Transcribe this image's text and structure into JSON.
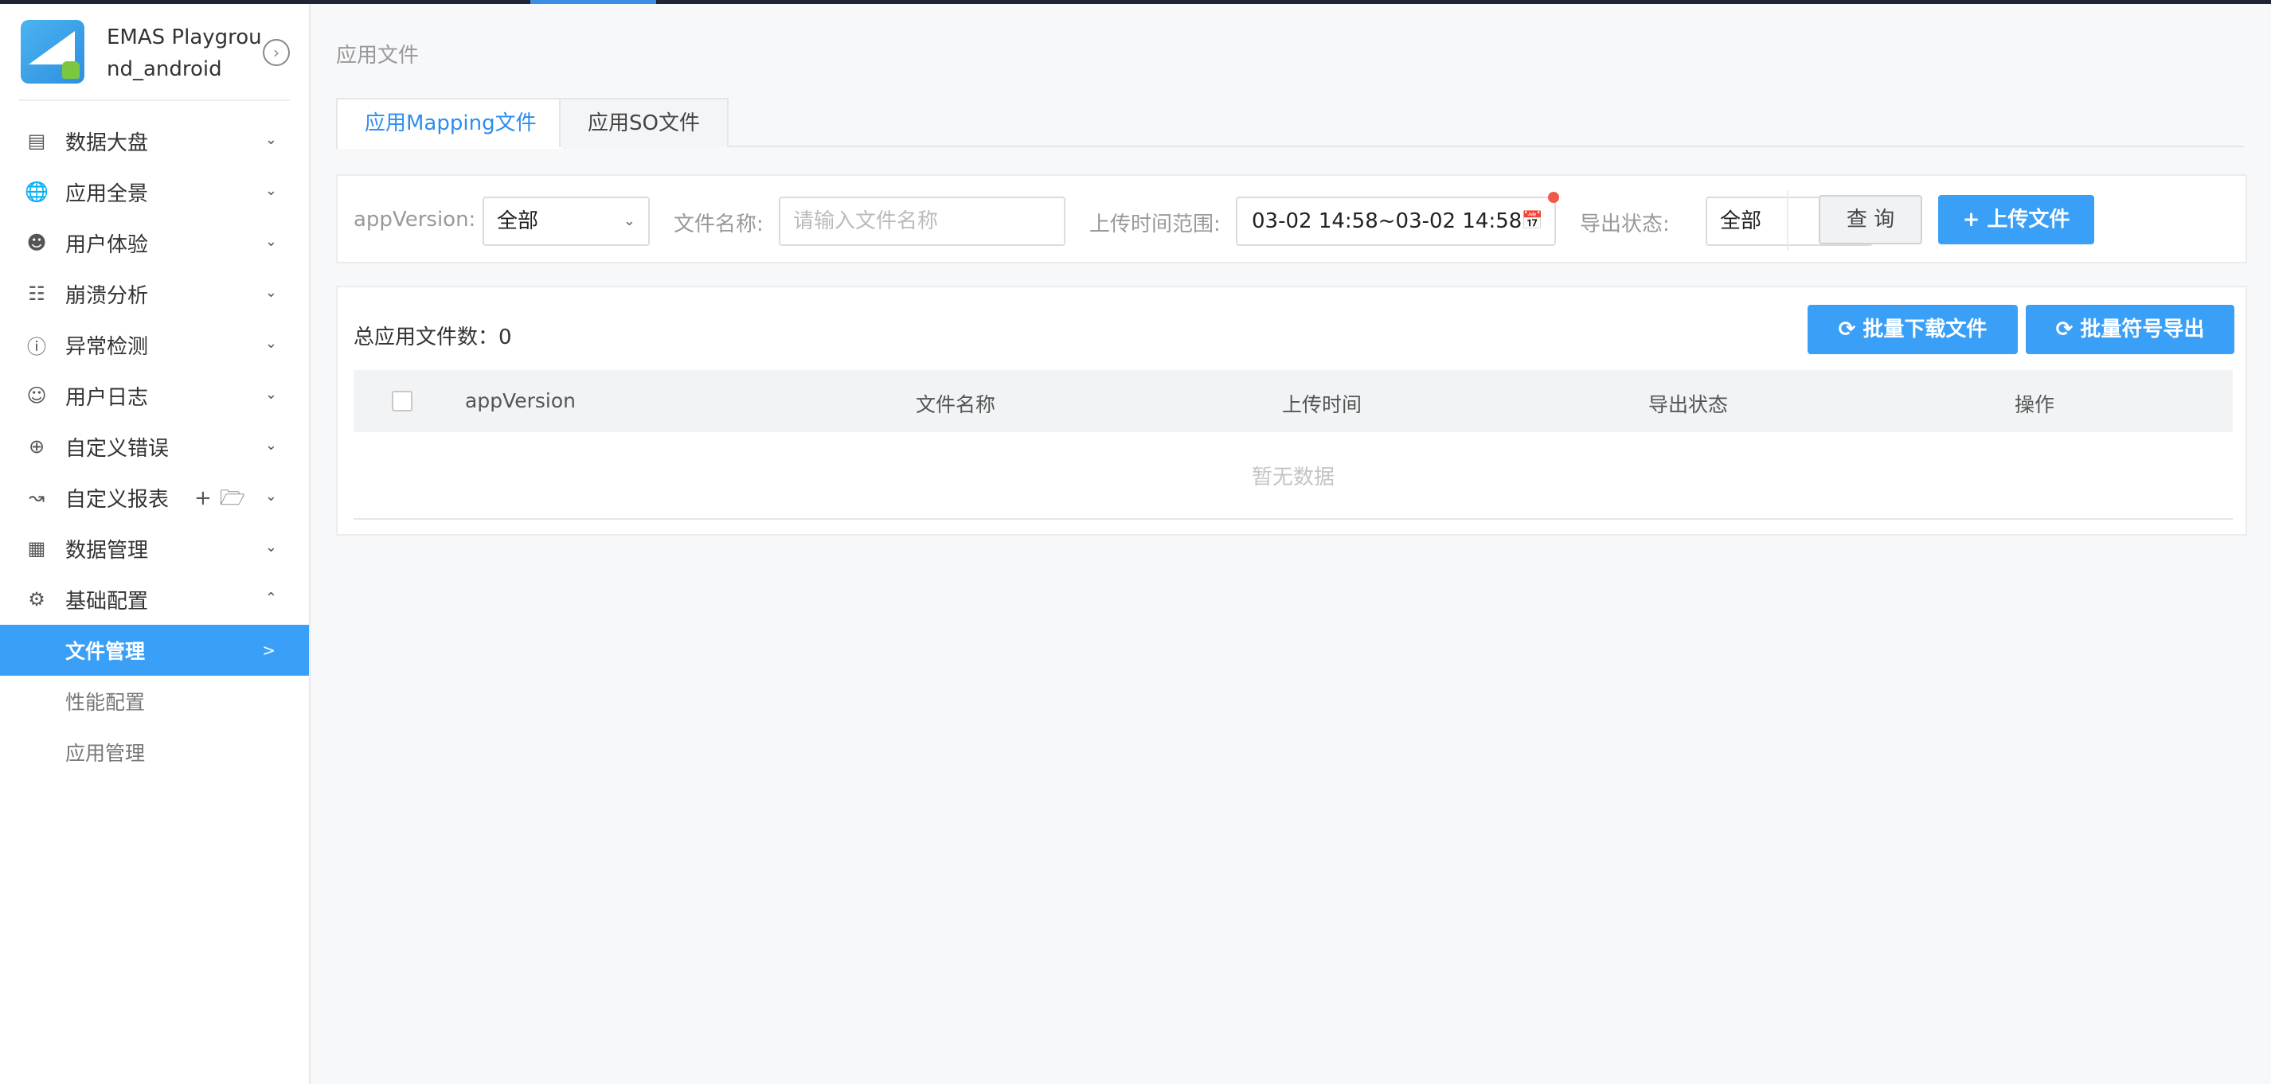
{
  "app": {
    "name": "EMAS Playground_android"
  },
  "sidebar": {
    "items": [
      {
        "label": "数据大盘",
        "icon": "dashboard-icon"
      },
      {
        "label": "应用全景",
        "icon": "globe-icon"
      },
      {
        "label": "用户体验",
        "icon": "user-icon"
      },
      {
        "label": "崩溃分析",
        "icon": "document-icon"
      },
      {
        "label": "异常检测",
        "icon": "alert-icon"
      },
      {
        "label": "用户日志",
        "icon": "user-log-icon"
      },
      {
        "label": "自定义错误",
        "icon": "target-icon"
      },
      {
        "label": "自定义报表",
        "icon": "chart-icon"
      },
      {
        "label": "数据管理",
        "icon": "database-icon"
      },
      {
        "label": "基础配置",
        "icon": "settings-icon"
      }
    ],
    "sub_items": [
      {
        "label": "文件管理",
        "active": true
      },
      {
        "label": "性能配置"
      },
      {
        "label": "应用管理"
      }
    ]
  },
  "page": {
    "title": "应用文件",
    "tabs": [
      {
        "label": "应用Mapping文件",
        "active": true
      },
      {
        "label": "应用SO文件"
      }
    ]
  },
  "filters": {
    "app_version_label": "appVersion:",
    "app_version_value": "全部",
    "file_name_label": "文件名称:",
    "file_name_placeholder": "请输入文件名称",
    "time_range_label": "上传时间范围:",
    "time_start": "03-02 14:58",
    "time_sep": "~",
    "time_end": "03-02 14:58",
    "export_status_label": "导出状态:",
    "export_status_value": "全部",
    "query_button": "查 询",
    "upload_button": "+ 上传文件"
  },
  "list": {
    "total_label": "总应用文件数：0",
    "batch_download_button": "批量下载文件",
    "batch_export_button": "批量符号导出",
    "columns": [
      "appVersion",
      "文件名称",
      "上传时间",
      "导出状态",
      "操作"
    ],
    "empty_text": "暂无数据"
  },
  "colors": {
    "primary": "#3a9ff6",
    "tab_active": "#2d8cf0"
  }
}
